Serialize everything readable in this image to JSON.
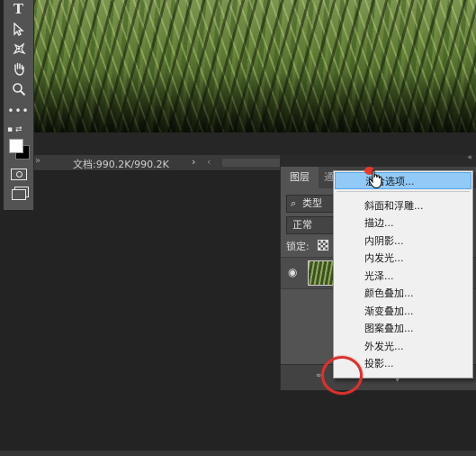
{
  "document": {
    "info": "文档:990.2K/990.2K",
    "nav_next": "›",
    "nav_prev": "‹",
    "tab_marker": "»"
  },
  "toolbar": {
    "tools": [
      "type-tool",
      "path-selection-tool",
      "puppet-warp-tool",
      "hand-tool",
      "zoom-tool",
      "edit-toolbar",
      "quick-mask",
      "screen-mode"
    ],
    "type_glyph": "T",
    "more_glyph": "•••",
    "foreground_color": "#ffffff",
    "background_color": "#000000"
  },
  "layers_panel": {
    "collapse_glyph": "«",
    "tabs": [
      "图层",
      "通"
    ],
    "filter_icon": "⌕",
    "filter_label": "类型",
    "blend_mode": "正常",
    "lock_label": "锁定:",
    "eye_glyph": "◉",
    "link_glyph": "⚭"
  },
  "context_menu": {
    "items": [
      "混合选项...",
      "斜面和浮雕...",
      "描边...",
      "内阴影...",
      "内发光...",
      "光泽...",
      "颜色叠加...",
      "渐变叠加...",
      "图案叠加...",
      "外发光...",
      "投影..."
    ],
    "highlighted_index": 0
  },
  "colors": {
    "menu_highlight": "#91c9f7",
    "click_marker": "#d9322d",
    "app_background": "#232323"
  }
}
